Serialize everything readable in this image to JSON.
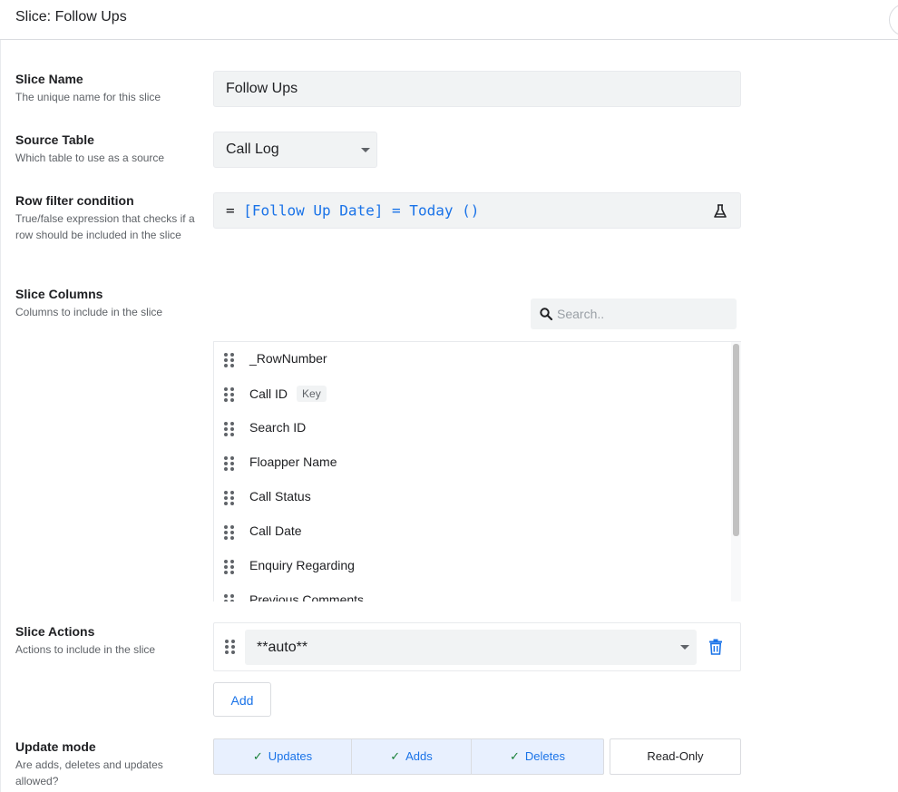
{
  "header": {
    "title": "Slice: Follow Ups"
  },
  "slice_name": {
    "label": "Slice Name",
    "description": "The unique name for this slice",
    "value": "Follow Ups"
  },
  "source_table": {
    "label": "Source Table",
    "description": "Which table to use as a source",
    "value": "Call Log"
  },
  "row_filter": {
    "label": "Row filter condition",
    "description": "True/false expression that checks if a row should be included in the slice",
    "prefix": "=",
    "expression": "[Follow Up Date] = Today ()"
  },
  "slice_columns": {
    "label": "Slice Columns",
    "description": "Columns to include in the slice",
    "search_placeholder": "Search..",
    "key_badge": "Key",
    "items": [
      "_RowNumber",
      "Call ID",
      "Search ID",
      "Floapper Name",
      "Call Status",
      "Call Date",
      "Enquiry Regarding",
      "Previous Comments"
    ]
  },
  "slice_actions": {
    "label": "Slice Actions",
    "description": "Actions to include in the slice",
    "value": "**auto**",
    "add_label": "Add"
  },
  "update_mode": {
    "label": "Update mode",
    "description": "Are adds, deletes and updates allowed?",
    "options": [
      {
        "label": "Updates",
        "selected": true
      },
      {
        "label": "Adds",
        "selected": true
      },
      {
        "label": "Deletes",
        "selected": true
      },
      {
        "label": "Read-Only",
        "selected": false
      }
    ]
  },
  "colors": {
    "accent": "#1a73e8",
    "check": "#188038",
    "field_bg": "#f1f3f4",
    "selected_bg": "#e8f0fe"
  }
}
